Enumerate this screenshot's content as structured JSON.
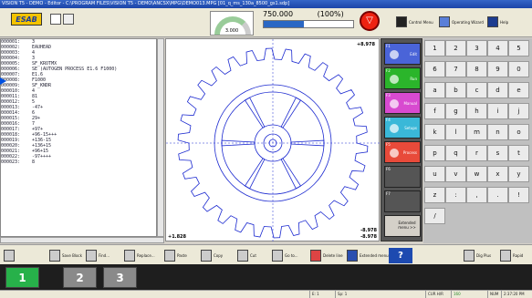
{
  "window": {
    "title": "VISION T5 - DEMO - Editor - C:\\PROGRAM FILES\\VISION T5 - DEMO\\ANCSX\\MPG\\DEMO013.MPG [01_q_ms_130a_8500_gs1.sdp]"
  },
  "toolbar": {
    "logo": "ESAB",
    "gauge_value": "3.000",
    "speed": "750.000",
    "speed_pct": "(100%)",
    "progress": 0.45,
    "control_menu": "Control Menu",
    "operating_wizard": "Operating Wizard",
    "help": "Help"
  },
  "code_lines": [
    {
      "n": "000001:",
      "t": "3"
    },
    {
      "n": "000002:",
      "t": "EAUHEAD"
    },
    {
      "n": "000003:",
      "t": "4"
    },
    {
      "n": "000004:",
      "t": "3"
    },
    {
      "n": "000005:",
      "t": "SF_KROTMX"
    },
    {
      "n": "000006:",
      "t": "SE (AUTOGEN PROCESS E1.6 F1000)"
    },
    {
      "n": "000007:",
      "t": "E1.6"
    },
    {
      "n": "000008:",
      "t": "F1000"
    },
    {
      "n": "000009:",
      "t": "SF_KNDR"
    },
    {
      "n": "000010:",
      "t": "4"
    },
    {
      "n": "000011:",
      "t": "81"
    },
    {
      "n": "000012:",
      "t": "5"
    },
    {
      "n": "000013:",
      "t": "-47+"
    },
    {
      "n": "000014:",
      "t": "6"
    },
    {
      "n": "000015:",
      "t": "29+"
    },
    {
      "n": "000016:",
      "t": "7"
    },
    {
      "n": "000017:",
      "t": "+97+"
    },
    {
      "n": "000018:",
      "t": "+96-15+++"
    },
    {
      "n": "000019:",
      "t": "+136-15"
    },
    {
      "n": "000020:",
      "t": "+136+15"
    },
    {
      "n": "000021:",
      "t": "+96+15"
    },
    {
      "n": "000022:",
      "t": "-97++++"
    },
    {
      "n": "000023:",
      "t": "8"
    }
  ],
  "plot": {
    "top_right": "+8.978",
    "bottom_left": "+1.828",
    "bottom_right_1": "-8.978",
    "bottom_right_2": "-8.978"
  },
  "modes": [
    {
      "fk": "F1",
      "label": "Edit",
      "color": "#4a64d8"
    },
    {
      "fk": "F2",
      "label": "Run",
      "color": "#2bb52b"
    },
    {
      "fk": "F3",
      "label": "Manual",
      "color": "#d84ad0"
    },
    {
      "fk": "F4",
      "label": "Setups",
      "color": "#3ab8d8"
    },
    {
      "fk": "F5",
      "label": "Process",
      "color": "#e84a3a"
    },
    {
      "fk": "F6",
      "label": "",
      "color": "#555555"
    },
    {
      "fk": "F7",
      "label": "",
      "color": "#555555"
    },
    {
      "fk": "",
      "label": "Extended menu >>",
      "color": "#d4d0c8"
    }
  ],
  "keypad": [
    "1",
    "2",
    "3",
    "4",
    "5",
    "6",
    "7",
    "8",
    "9",
    "0",
    "a",
    "b",
    "c",
    "d",
    "e",
    "f",
    "g",
    "h",
    "i",
    "j",
    "k",
    "l",
    "m",
    "n",
    "o",
    "p",
    "q",
    "r",
    "s",
    "t",
    "u",
    "v",
    "w",
    "x",
    "y",
    "z",
    ":",
    ",",
    ".",
    "!",
    "/",
    "=",
    "_",
    "←",
    "+",
    "↑",
    "-",
    "Tab",
    "Caps",
    "←",
    "↓",
    "→",
    "Enter",
    "Space"
  ],
  "bottom": {
    "new": "",
    "save": "Save Block",
    "find": "Find...",
    "replace": "Replace...",
    "paste": "Paste",
    "copy": "Copy",
    "cut": "Cut",
    "goto": "Go to...",
    "delete": "Delete line",
    "extended": "Extended menu >>",
    "help": "?",
    "dig": "Dig Plus",
    "rapid": "Rapid"
  },
  "tabs": [
    "1",
    "2",
    "3"
  ],
  "status": {
    "e": "E: 1",
    "sp": "Sp: 1",
    "cur": "CUR H/R",
    "lvl": "160",
    "num": "NUM",
    "time": "2:37:20 PM"
  }
}
